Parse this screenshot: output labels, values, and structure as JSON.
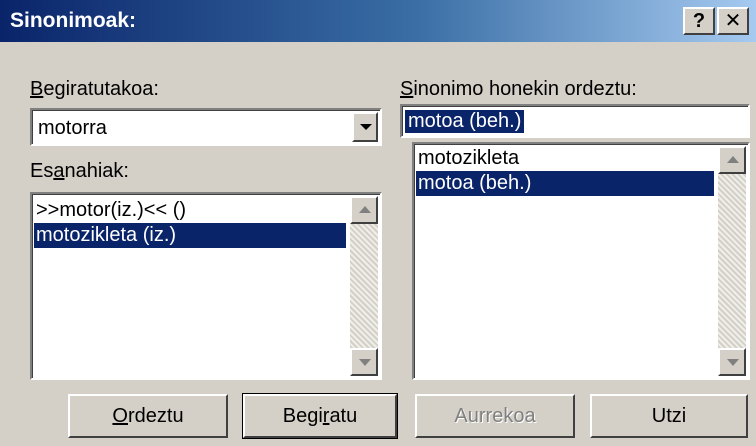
{
  "window": {
    "title": "Sinonimoak:",
    "help_glyph": "?",
    "close_glyph": "✕"
  },
  "looked_up": {
    "label_accel": "B",
    "label_rest": "egiratutakoa:",
    "value": "motorra"
  },
  "meanings": {
    "label_pre": "Es",
    "label_accel": "a",
    "label_rest": "nahiak:",
    "items": [
      ">>motor(iz.)<< ()",
      "motozikleta (iz.)"
    ],
    "selected_index": 1
  },
  "replace_with": {
    "label_accel": "S",
    "label_rest": "inonimo honekin ordeztu:",
    "value": "motoa (beh.)",
    "items": [
      "motozikleta",
      "motoa (beh.)"
    ],
    "selected_index": 1
  },
  "buttons": {
    "replace_accel": "O",
    "replace_rest": "rdeztu",
    "lookup_pre": "Begi",
    "lookup_accel": "r",
    "lookup_rest": "atu",
    "previous": "Aurrekoa",
    "cancel": "Utzi"
  },
  "colors": {
    "selection": "#0a246a",
    "face": "#d4d0c8"
  }
}
